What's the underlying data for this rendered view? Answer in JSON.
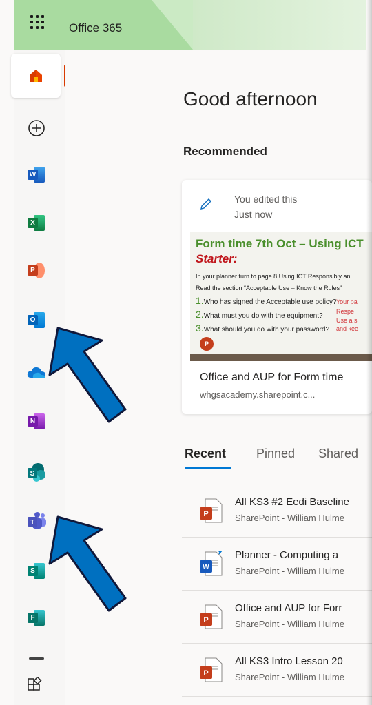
{
  "header": {
    "brand": "Office 365",
    "waffle_icon": "waffle-icon"
  },
  "rail": {
    "items": [
      {
        "name": "home",
        "icon": "home-icon"
      },
      {
        "name": "create",
        "icon": "plus-circle-icon"
      },
      {
        "name": "word",
        "icon": "word-icon",
        "letter": "W",
        "color": "#2b579a"
      },
      {
        "name": "excel",
        "icon": "excel-icon",
        "letter": "X",
        "color": "#217346"
      },
      {
        "name": "powerpoint",
        "icon": "powerpoint-icon",
        "letter": "P",
        "color": "#c43e1c"
      },
      {
        "name": "outlook",
        "icon": "outlook-icon",
        "letter": "O",
        "color": "#0072c6"
      },
      {
        "name": "onedrive",
        "icon": "onedrive-icon"
      },
      {
        "name": "onenote",
        "icon": "onenote-icon",
        "letter": "N",
        "color": "#7719aa"
      },
      {
        "name": "sharepoint",
        "icon": "sharepoint-icon",
        "letter": "S",
        "color": "#038387"
      },
      {
        "name": "teams",
        "icon": "teams-icon",
        "color": "#5b5fc7"
      },
      {
        "name": "sway",
        "icon": "sway-icon",
        "letter": "S",
        "color": "#008272"
      },
      {
        "name": "forms",
        "icon": "forms-icon",
        "letter": "F",
        "color": "#077568"
      },
      {
        "name": "all-apps",
        "icon": "all-apps-icon"
      }
    ]
  },
  "main": {
    "greeting": "Good afternoon",
    "recommended_label": "Recommended",
    "recommended_card": {
      "activity_line1": "You edited this",
      "activity_line2": "Just now",
      "thumbnail": {
        "title": "Form time 7th Oct – Using ICT",
        "starter": "Starter:",
        "line1": "In your planner turn to page 8 Using ICT Responsibly an",
        "line2": "Read the section “Acceptable Use – Know the Rules”",
        "q1": "Who has signed the Acceptable use policy?",
        "q2": "What must you do with the equipment?",
        "q3": "What should you do with your password?",
        "bullet1": "Your pa",
        "bullet2": "Respe",
        "bullet3": "Use a s",
        "bullet4": "and kee"
      },
      "title": "Office and AUP for Form time",
      "location": "whgsacademy.sharepoint.c..."
    },
    "tabs": [
      "Recent",
      "Pinned",
      "Shared"
    ],
    "files": [
      {
        "name": "All KS3 #2 Eedi Baseline",
        "location": "SharePoint - William Hulme",
        "type": "powerpoint-file-icon"
      },
      {
        "name": "Planner - Computing a",
        "location": "SharePoint - William Hulme",
        "type": "word-file-icon"
      },
      {
        "name": "Office and AUP for Forr",
        "location": "SharePoint - William Hulme",
        "type": "powerpoint-file-icon"
      },
      {
        "name": "All KS3 Intro Lesson 20",
        "location": "SharePoint - William Hulme",
        "type": "powerpoint-file-icon"
      }
    ]
  },
  "annotations": {
    "arrow_color": "#0070c0"
  }
}
